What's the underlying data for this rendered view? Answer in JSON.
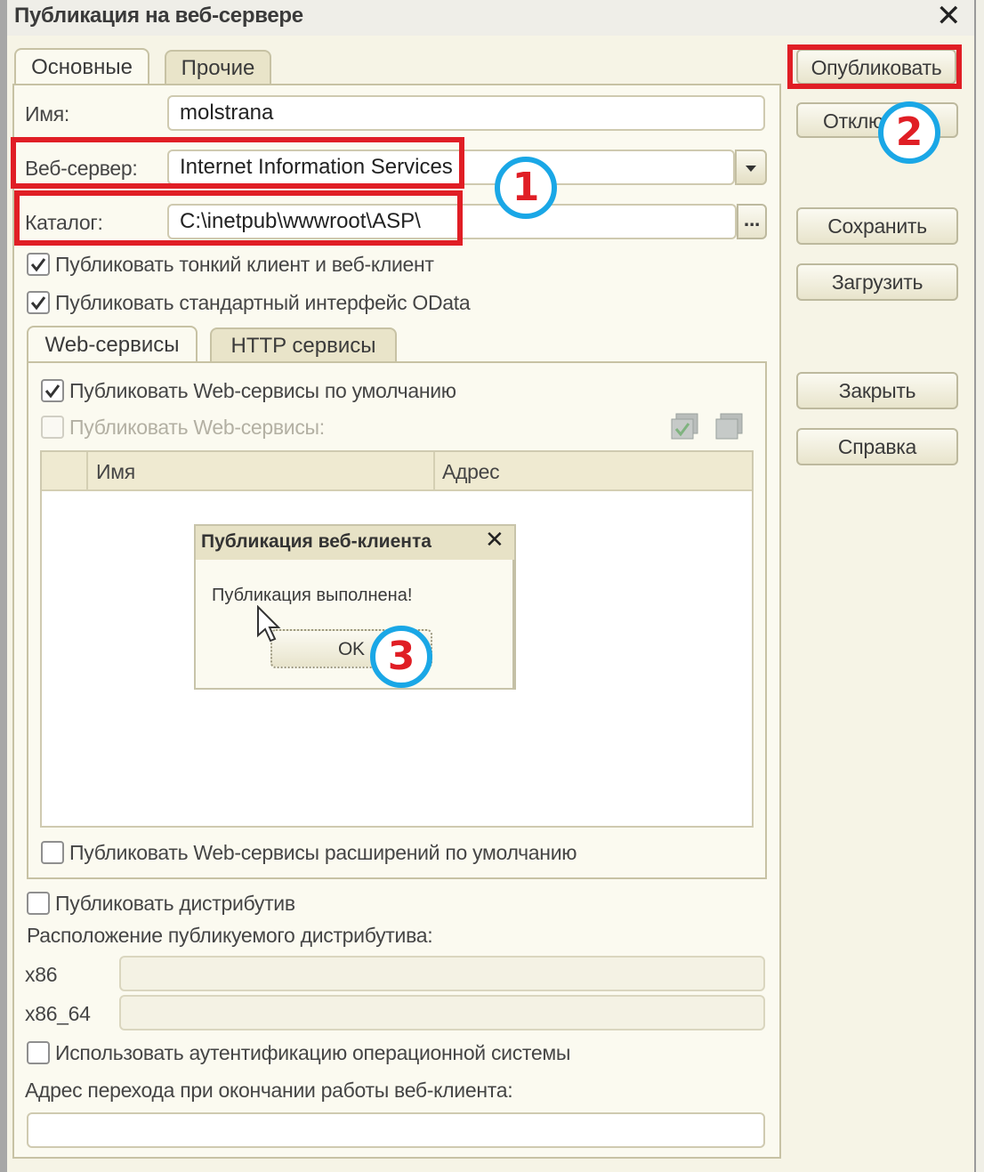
{
  "window": {
    "title": "Публикация на веб-сервере",
    "close": "✕"
  },
  "tabs": {
    "main": "Основные",
    "other": "Прочие"
  },
  "fields": {
    "name_label": "Имя:",
    "name_value": "molstrana",
    "webserver_label": "Веб-сервер:",
    "webserver_value": "Internet Information Services",
    "catalog_label": "Каталог:",
    "catalog_value": "C:\\inetpub\\wwwroot\\ASP\\",
    "browse": "..."
  },
  "checkboxes": {
    "thin_client": {
      "label": "Публиковать тонкий клиент и веб-клиент",
      "checked": true
    },
    "odata": {
      "label": "Публиковать стандартный интерфейс OData",
      "checked": true
    },
    "ws_default": {
      "label": "Публиковать Web-сервисы по умолчанию",
      "checked": true
    },
    "ws_publish": {
      "label": "Публиковать Web-сервисы:",
      "checked": false
    },
    "ws_ext_default": {
      "label": "Публиковать Web-сервисы расширений по умолчанию",
      "checked": false
    },
    "distrib": {
      "label": "Публиковать дистрибутив",
      "checked": false
    },
    "os_auth": {
      "label": "Использовать аутентификацию операционной системы",
      "checked": false
    }
  },
  "inner_tabs": {
    "web": "Web-сервисы",
    "http": "HTTP сервисы"
  },
  "grid": {
    "col_name": "Имя",
    "col_address": "Адрес"
  },
  "distrib": {
    "location_label": "Расположение публикуемого дистрибутива:",
    "x86_label": "x86",
    "x64_label": "x86_64"
  },
  "exit_address_label": "Адрес перехода при окончании работы веб-клиента:",
  "buttons": {
    "publish": "Опубликовать",
    "unpublish": "Отклю",
    "save": "Сохранить",
    "load": "Загрузить",
    "close": "Закрыть",
    "help": "Справка"
  },
  "dialog": {
    "title": "Публикация веб-клиента",
    "close": "✕",
    "message": "Публикация выполнена!",
    "ok": "OK"
  },
  "badges": {
    "b1": "1",
    "b2": "2",
    "b3": "3"
  },
  "colors": {
    "highlight_red": "#e01e25",
    "badge_blue": "#1aa7e6"
  }
}
